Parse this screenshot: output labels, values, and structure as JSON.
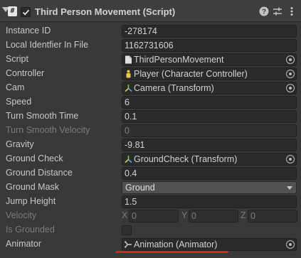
{
  "component": {
    "title": "Third Person Movement (Script)",
    "script_icon_glyph": "#",
    "enabled": true
  },
  "fields": {
    "instance_id": {
      "label": "Instance ID",
      "value": "-278174"
    },
    "local_identifier": {
      "label": "Local Identfier In File",
      "value": "1162731606"
    },
    "script": {
      "label": "Script",
      "value": "ThirdPersonMovement",
      "icon": "script-file-icon"
    },
    "controller": {
      "label": "Controller",
      "value": "Player (Character Controller)",
      "icon": "character-controller-icon"
    },
    "cam": {
      "label": "Cam",
      "value": "Camera (Transform)",
      "icon": "transform-icon"
    },
    "speed": {
      "label": "Speed",
      "value": "6"
    },
    "turn_smooth_time": {
      "label": "Turn Smooth Time",
      "value": "0.1"
    },
    "turn_smooth_velocity": {
      "label": "Turn Smooth Velocity",
      "value": "0"
    },
    "gravity": {
      "label": "Gravity",
      "value": "-9.81"
    },
    "ground_check": {
      "label": "Ground Check",
      "value": "GroundCheck (Transform)",
      "icon": "transform-icon"
    },
    "ground_distance": {
      "label": "Ground Distance",
      "value": "0.4"
    },
    "ground_mask": {
      "label": "Ground Mask",
      "value": "Ground"
    },
    "jump_height": {
      "label": "Jump Height",
      "value": "1.5"
    },
    "velocity": {
      "label": "Velocity",
      "x_label": "X",
      "x": "0",
      "y_label": "Y",
      "y": "0",
      "z_label": "Z",
      "z": "0"
    },
    "is_grounded": {
      "label": "Is Grounded",
      "checked": false
    },
    "animator": {
      "label": "Animator",
      "value": "Animation (Animator)",
      "icon": "animator-icon"
    }
  },
  "colors": {
    "highlight_underline": "#d42525"
  }
}
